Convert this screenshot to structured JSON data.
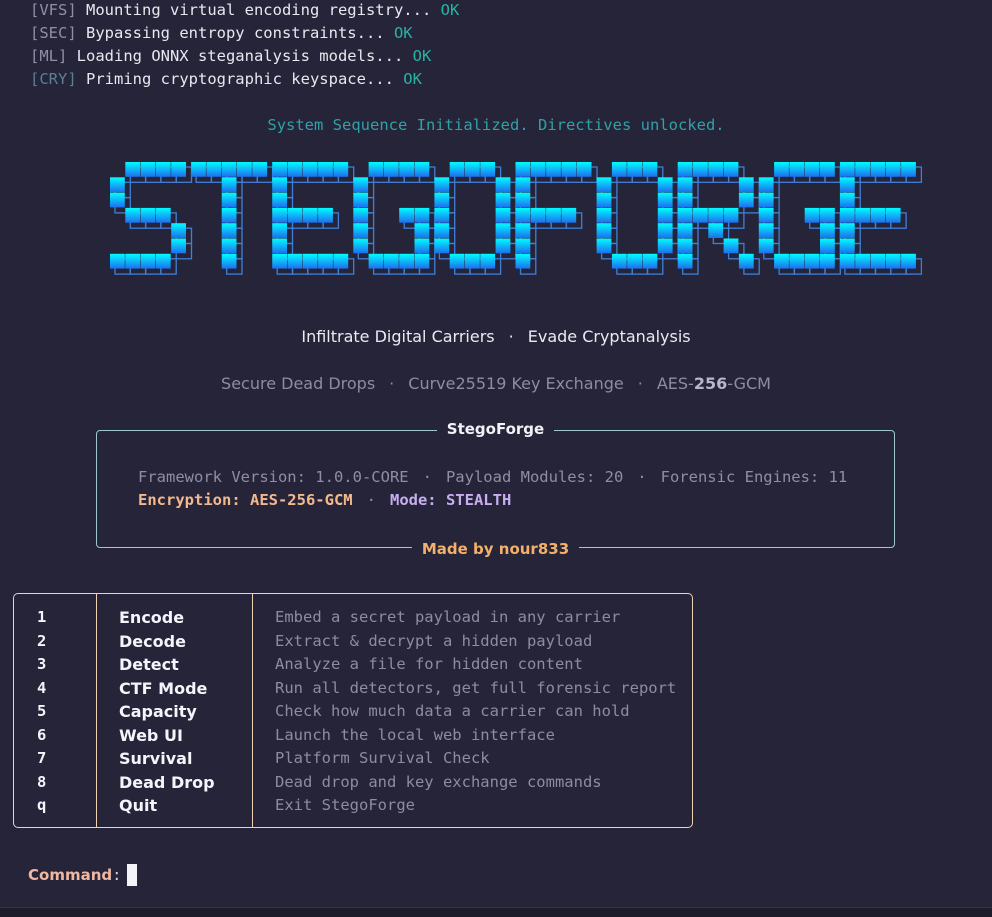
{
  "boot": [
    {
      "tag": "[VFS]",
      "text": " Mounting virtual encoding registry... ",
      "status": "OK"
    },
    {
      "tag": "[SEC]",
      "text": " Bypassing entropy constraints... ",
      "status": "OK"
    },
    {
      "tag": "[ML]",
      "text": " Loading ONNX steganalysis models... ",
      "status": "OK"
    },
    {
      "tag": "[CRY]",
      "text": " Priming cryptographic keyspace... ",
      "status": "OK"
    }
  ],
  "system_message": "System Sequence Initialized. Directives unlocked.",
  "logo": {
    "text": "STEGOFORGE",
    "gradient_top": "#00fdff",
    "gradient_bottom": "#1d6ff0"
  },
  "tagline": {
    "part1": "Infiltrate Digital Carriers",
    "separator": "·",
    "part2": "Evade Cryptanalysis"
  },
  "features": {
    "item1": "Secure Dead Drops",
    "item2": "Curve25519 Key Exchange",
    "item3_pre": "AES-",
    "item3_bold": "256",
    "item3_post": "-GCM",
    "separator": "·"
  },
  "panel": {
    "title": "StegoForge",
    "footer": "Made by nour833",
    "line1": {
      "framework": "Framework Version: 1.0.0-CORE",
      "modules": "Payload Modules: 20",
      "engines": "Forensic Engines: 11",
      "separator": "·"
    },
    "line2": {
      "encryption": "Encryption: AES-256-GCM",
      "separator": "·",
      "mode": "Mode: STEALTH"
    }
  },
  "menu": [
    {
      "key": "1",
      "name": "Encode",
      "desc": "Embed a secret payload in any carrier"
    },
    {
      "key": "2",
      "name": "Decode",
      "desc": "Extract & decrypt a hidden payload"
    },
    {
      "key": "3",
      "name": "Detect",
      "desc": "Analyze a file for hidden content"
    },
    {
      "key": "4",
      "name": "CTF Mode",
      "desc": "Run all detectors, get full forensic report"
    },
    {
      "key": "5",
      "name": "Capacity",
      "desc": "Check how much data a carrier can hold"
    },
    {
      "key": "6",
      "name": "Web UI",
      "desc": "Launch the local web interface"
    },
    {
      "key": "7",
      "name": "Survival",
      "desc": "Platform Survival Check"
    },
    {
      "key": "8",
      "name": "Dead Drop",
      "desc": "Dead drop and key exchange commands"
    },
    {
      "key": "q",
      "name": "Quit",
      "desc": "Exit StegoForge"
    }
  ],
  "prompt": {
    "label": "Command",
    "colon": ":"
  }
}
